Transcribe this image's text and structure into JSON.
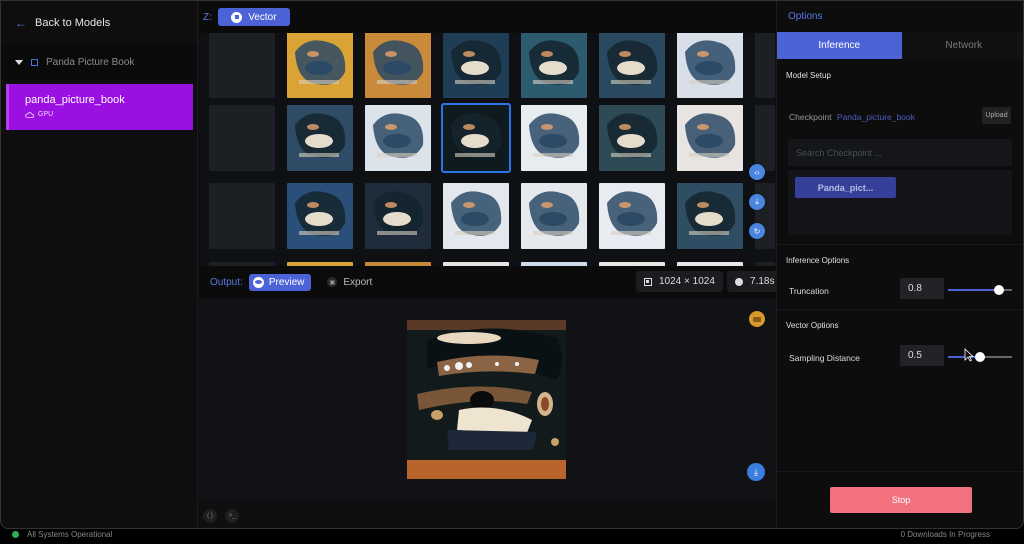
{
  "sidebar": {
    "back_label": "Back to Models",
    "project_name": "Panda Picture Book",
    "model": {
      "name": "panda_picture_book",
      "device": "GPU"
    }
  },
  "latent": {
    "z_label": "Z:",
    "mode_label": "Vector",
    "grid": {
      "rows": 4,
      "cols": 6,
      "selected": {
        "row": 1,
        "col": 2
      },
      "tiles": [
        [
          "#d9a335",
          "#c98a3a",
          "#1f3d55",
          "#2c5a6e",
          "#294a5e",
          "#d8dfe8"
        ],
        [
          "#2e4c66",
          "#dde3ea",
          "#0f1a1f",
          "#e6ecef",
          "#2e4a55",
          "#e8e4e2"
        ],
        [
          "#2a4f78",
          "#1e2c3c",
          "#e3e8ef",
          "#e5e9ee",
          "#e8ecf2",
          "#2f4e63"
        ],
        [
          "#d6a236",
          "#c6883a",
          "#e6e4e0",
          "#cfdced",
          "#e8e6e2",
          "#e8e8ea"
        ]
      ]
    },
    "side_actions": [
      "code-icon",
      "download-icon",
      "refresh-icon"
    ]
  },
  "output": {
    "label": "Output:",
    "preview_label": "Preview",
    "export_label": "Export",
    "resolution": "1024 × 1024",
    "time": "7.18s"
  },
  "options": {
    "title": "Options",
    "tabs": [
      {
        "label": "Inference",
        "active": true
      },
      {
        "label": "Network",
        "active": false
      }
    ],
    "model_setup": {
      "title": "Model Setup",
      "checkpoint_label": "Checkpoint",
      "checkpoint_value": "Panda_picture_book",
      "upload_label": "Upload",
      "search_placeholder": "Search Checkpoint ...",
      "items": [
        "Panda_pict..."
      ]
    },
    "inference_options": {
      "title": "Inference Options",
      "truncation": {
        "label": "Truncation",
        "value": "0.8",
        "fraction": 0.8
      }
    },
    "vector_options": {
      "title": "Vector Options",
      "sampling_distance": {
        "label": "Sampling Distance",
        "value": "0.5",
        "fraction": 0.5
      }
    },
    "stop_label": "Stop"
  },
  "status": {
    "system": "All Systems Operational",
    "downloads": "0 Downloads In Progress"
  }
}
